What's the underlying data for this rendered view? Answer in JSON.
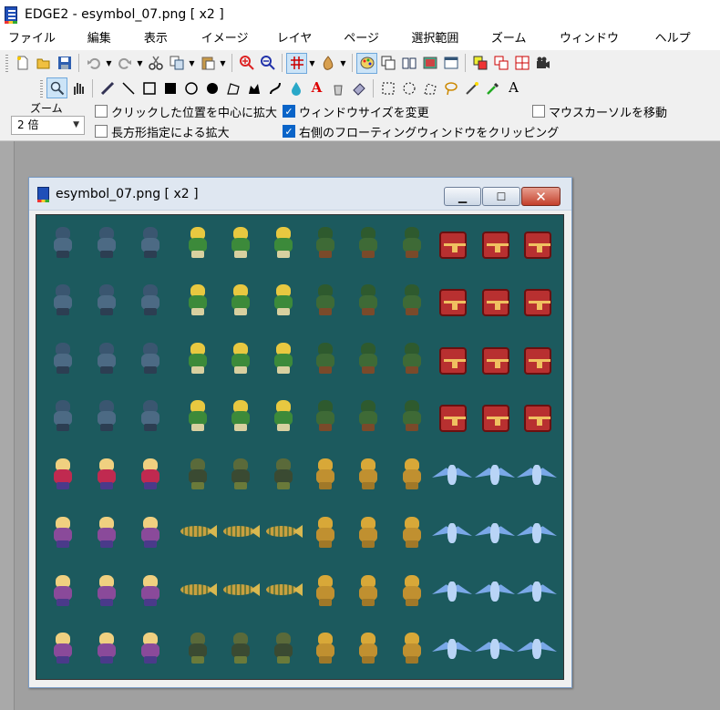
{
  "window": {
    "title": "EDGE2 - esymbol_07.png [ x2 ]"
  },
  "menu": [
    "ファイル(F)",
    "編集(E)",
    "表示(V)",
    "イメージ(I)",
    "レイヤ(L)",
    "ページ(P)",
    "選択範囲(S)",
    "ズーム(Z)",
    "ウィンドウ(W)",
    "ヘルプ(H)"
  ],
  "toolbar1": {
    "icons": [
      "new-icon",
      "open-icon",
      "save-icon",
      "undo-icon",
      "redo-icon",
      "cut-icon",
      "copy-icon",
      "paste-icon",
      "zoom-in-icon",
      "zoom-out-icon",
      "grid-icon",
      "onion-icon",
      "palette-icon",
      "layers-icon",
      "book-icon",
      "image-icon",
      "window-icon",
      "anim-icon",
      "frames-icon",
      "grid-split-icon",
      "camera-icon"
    ]
  },
  "toolbar2": {
    "icons": [
      "magnifier-icon",
      "hand-icon",
      "pencil-icon",
      "line-icon",
      "rect-icon",
      "fill-rect-icon",
      "ellipse-icon",
      "fill-ellipse-icon",
      "polygon-icon",
      "fill-polygon-icon",
      "curve-icon",
      "drop-icon",
      "text-a-icon",
      "bucket-icon",
      "eraser-icon",
      "select-rect-icon",
      "select-ellipse-icon",
      "select-poly-icon",
      "lasso-icon",
      "wand-icon",
      "eyedropper-icon",
      "text-icon"
    ]
  },
  "options": {
    "zoom_label": "ズーム",
    "zoom_value": "2 倍",
    "click_center": "クリックした位置を中心に拡大",
    "rect_zoom": "長方形指定による拡大",
    "window_size_change": "ウィンドウサイズを変更",
    "clip_floating": "右側のフローティングウィンドウをクリッピング",
    "move_cursor": "マウスカーソルを移動"
  },
  "child": {
    "title": "esymbol_07.png [ x2 ]"
  },
  "colors": {
    "canvas_bg": "#1c5a5e",
    "knight": "#4c6a84",
    "elf_hair": "#e8c840",
    "orc": "#3e6a36",
    "chest": "#b83030",
    "girl": "#f0d080",
    "imp": "#d8a838",
    "bird": "#7aa8e8"
  }
}
